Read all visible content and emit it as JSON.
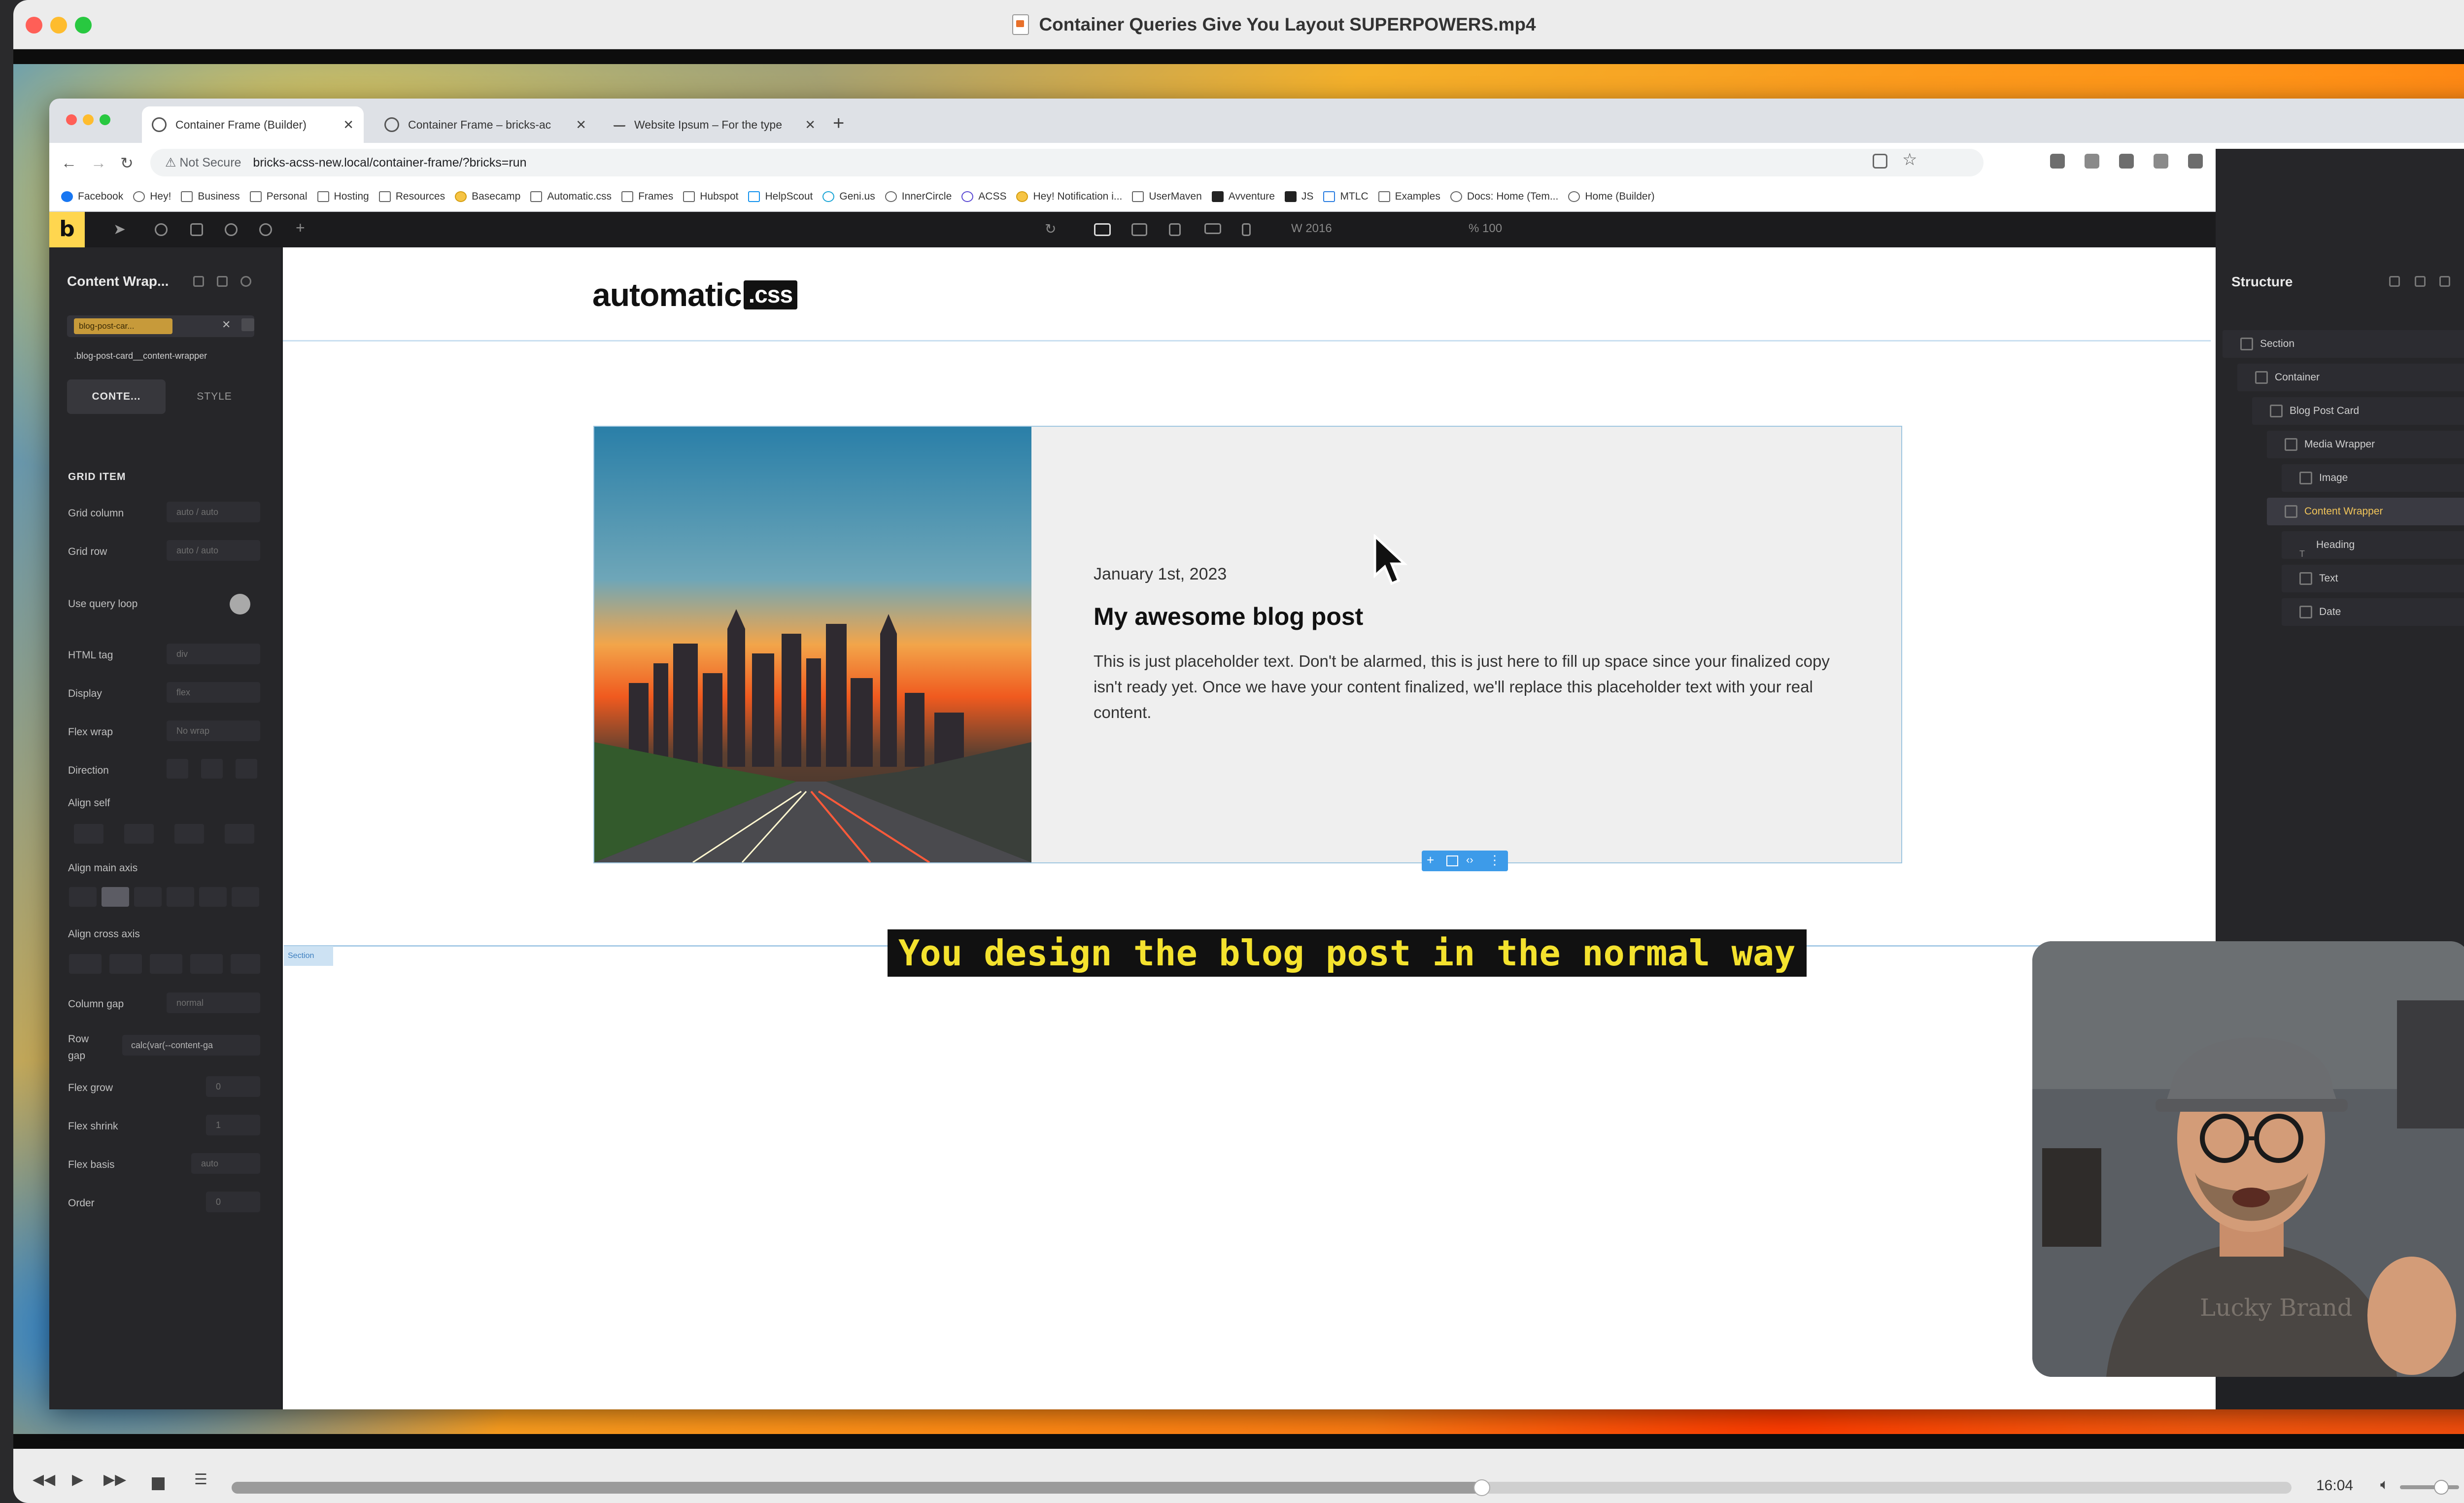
{
  "player": {
    "window_title": "Container Queries Give You Layout SUPERPOWERS.mp4",
    "time": "16:04",
    "progress": 0.607,
    "volume": 0.7
  },
  "browser": {
    "tabs": [
      {
        "label": "Container Frame (Builder)",
        "active": true
      },
      {
        "label": "Container Frame – bricks-ac",
        "active": false
      },
      {
        "label": "Website Ipsum – For the type",
        "active": false
      }
    ],
    "not_secure": "Not Secure",
    "url": "bricks-acss-new.local/container-frame/?bricks=run",
    "bookmarks": [
      "Facebook",
      "Hey!",
      "Business",
      "Personal",
      "Hosting",
      "Resources",
      "Basecamp",
      "Automatic.css",
      "Frames",
      "Hubspot",
      "HelpScout",
      "Geni.us",
      "InnerCircle",
      "ACSS",
      "Hey! Notification i...",
      "UserMaven",
      "Avventure",
      "JS",
      "MTLC",
      "Examples",
      "Docs: Home (Tem...",
      "Home (Builder)"
    ]
  },
  "builder": {
    "logo": "b",
    "canvas_width": "2016",
    "canvas_scale": "100",
    "left_panel": {
      "title": "Content Wrap...",
      "class_chip": "blog-post-car...",
      "class_sub": ".blog-post-card__content-wrapper",
      "tab_content": "CONTE...",
      "tab_style": "STYLE",
      "section": "GRID ITEM",
      "grid_column": "Grid column",
      "grid_column_ph": "auto / auto",
      "grid_row": "Grid row",
      "grid_row_ph": "auto / auto",
      "use_query_loop": "Use query loop",
      "html_tag": "HTML tag",
      "html_tag_val": "div",
      "display": "Display",
      "display_val": "flex",
      "flex_wrap": "Flex wrap",
      "flex_wrap_val": "No wrap",
      "direction": "Direction",
      "align_self": "Align self",
      "align_main": "Align main axis",
      "align_cross": "Align cross axis",
      "column_gap": "Column gap",
      "column_gap_val": "normal",
      "row_gap": "Row gap",
      "row_gap_val": "calc(var(--content-ga",
      "flex_grow": "Flex grow",
      "flex_grow_val": "0",
      "flex_shrink": "Flex shrink",
      "flex_shrink_val": "1",
      "flex_basis": "Flex basis",
      "flex_basis_val": "auto",
      "order": "Order",
      "order_val": "0"
    },
    "structure": {
      "title": "Structure",
      "items": [
        {
          "label": "Section",
          "level": 0
        },
        {
          "label": "Container",
          "level": 1
        },
        {
          "label": "Blog Post Card",
          "level": 2
        },
        {
          "label": "Media Wrapper",
          "level": 3
        },
        {
          "label": "Image",
          "level": 4
        },
        {
          "label": "Content Wrapper",
          "level": 3,
          "selected": true
        },
        {
          "label": "Heading",
          "level": 4
        },
        {
          "label": "Text",
          "level": 4
        },
        {
          "label": "Date",
          "level": 4
        }
      ]
    }
  },
  "page": {
    "logo_text": "automatic",
    "logo_suffix": ".css",
    "section_tag": "Section",
    "card": {
      "date": "January 1st, 2023",
      "title": "My awesome blog post",
      "text": "This is just placeholder text. Don't be alarmed, this is just here to fill up space since your finalized copy isn't ready yet. Once we have your content finalized, we'll replace this placeholder text with your real content."
    }
  },
  "subtitle": "You design the blog post in the normal way",
  "colors": {
    "bricks_yellow": "#ffd64f",
    "selection_blue": "#3d9be9",
    "subtitle_yellow": "#f4e22e"
  }
}
